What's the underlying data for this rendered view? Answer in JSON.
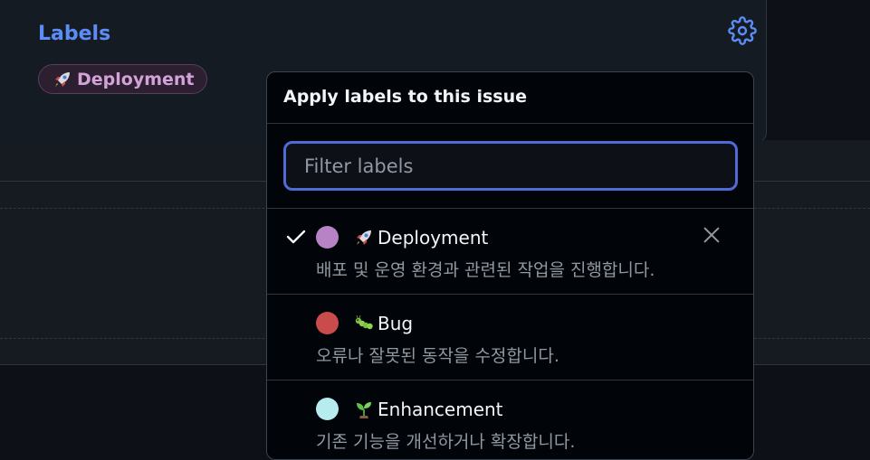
{
  "sidebar": {
    "heading": "Labels",
    "applied_label": {
      "name": "Deployment",
      "icon": "rocket-icon",
      "color": "#d2a2d9"
    }
  },
  "dropdown": {
    "title": "Apply labels to this issue",
    "filter": {
      "placeholder": "Filter labels",
      "value": ""
    },
    "items": [
      {
        "name": "Deployment",
        "icon": "rocket-icon",
        "color": "#b783c4",
        "description": "배포 및 운영 환경과 관련된 작업을 진행합니다.",
        "selected": true
      },
      {
        "name": "Bug",
        "icon": "caterpillar-icon",
        "color": "#c94b4b",
        "description": "오류나 잘못된 동작을 수정합니다.",
        "selected": false
      },
      {
        "name": "Enhancement",
        "icon": "seedling-icon",
        "color": "#b6ecee",
        "description": "기존 기능을 개선하거나 확장합니다.",
        "selected": false
      }
    ]
  },
  "colors": {
    "accent": "#5c8cf5",
    "focus_border": "#4f6bd6",
    "background": "#0d1117"
  }
}
